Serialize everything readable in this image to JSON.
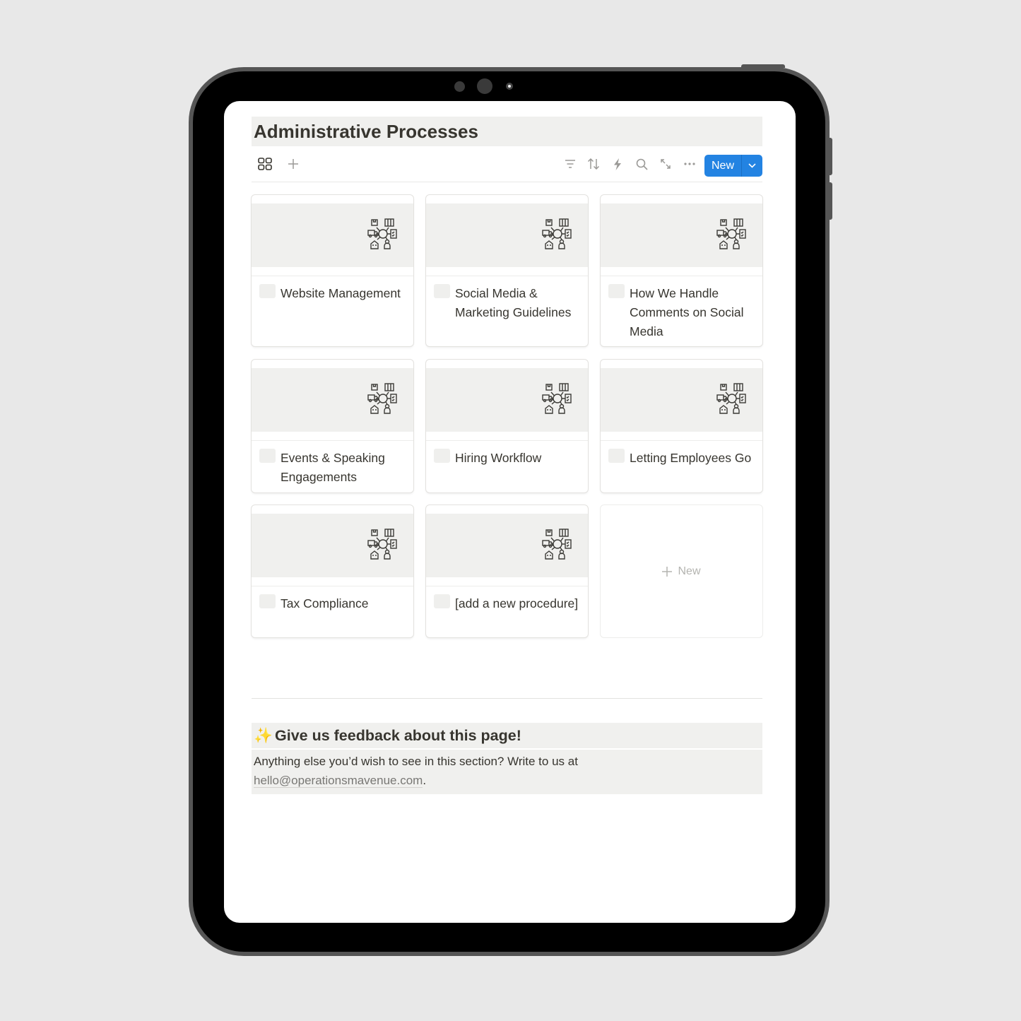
{
  "page": {
    "title": "Administrative Processes"
  },
  "toolbar": {
    "view_icon": "gallery-grid-icon",
    "add_view_icon": "plus-icon",
    "icons": [
      "filter-icon",
      "sort-icon",
      "automation-bolt-icon",
      "search-icon",
      "expand-icon",
      "more-icon"
    ],
    "new_button_label": "New",
    "new_dropdown_icon": "chevron-down-icon",
    "accent_color": "#2383e2"
  },
  "gallery": {
    "cover_icon": "operations-hub-icon",
    "cards": [
      {
        "title": "Website Management"
      },
      {
        "title": "Social Media & Marketing Guidelines"
      },
      {
        "title": "How We Handle Comments on Social Media"
      },
      {
        "title": "Events & Speaking Engagements"
      },
      {
        "title": "Hiring Workflow"
      },
      {
        "title": "Letting Employees Go"
      },
      {
        "title": "Tax Compliance"
      },
      {
        "title": "[add a new procedure]"
      }
    ],
    "new_card_label": "New"
  },
  "feedback": {
    "emoji": "✨",
    "heading": "Give us feedback about this page!",
    "text": "Anything else you’d wish to see in this section? Write to us at",
    "email": "hello@operationsmavenue.com",
    "trailing": "."
  }
}
